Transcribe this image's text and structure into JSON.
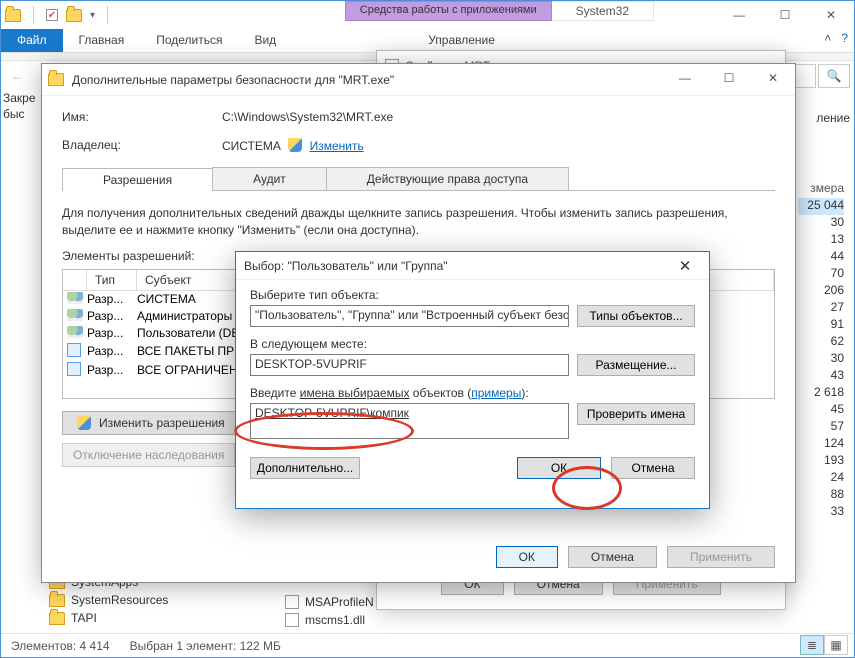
{
  "explorer": {
    "context_tab": "Средства работы с приложениями",
    "path_label": "System32",
    "ribbon": {
      "file": "Файл",
      "home": "Главная",
      "share": "Поделиться",
      "view": "Вид",
      "manage": "Управление"
    },
    "left_clip": "Закре\nбыс",
    "right_clip": "ление",
    "size_header": "змера",
    "sizes": [
      "25 044",
      "30",
      "13",
      "44",
      "70",
      "206",
      "27",
      "91",
      "62",
      "30",
      "43",
      "2 618",
      "45",
      "57",
      "124",
      "193",
      "24",
      "88",
      "33"
    ],
    "folder_items": [
      "SystemResources",
      "TAPI"
    ],
    "folder_item_top": "SystemApps",
    "file_items": [
      "MSAProfileN",
      "mscms1.dll"
    ],
    "status": {
      "count_label": "Элементов: 4 414",
      "selected_label": "Выбран 1 элемент: 122 МБ"
    }
  },
  "props": {
    "title": "Свойства: MRT.exe",
    "ok": "ОК",
    "cancel": "Отмена",
    "apply": "Применить"
  },
  "advsec": {
    "title": "Дополнительные параметры безопасности для \"MRT.exe\"",
    "name_label": "Имя:",
    "name_value": "C:\\Windows\\System32\\MRT.exe",
    "owner_label": "Владелец:",
    "owner_value": "СИСТЕМА",
    "change_link": "Изменить",
    "tabs": {
      "perm": "Разрешения",
      "audit": "Аудит",
      "effective": "Действующие права доступа"
    },
    "hint": "Для получения дополнительных сведений дважды щелкните запись разрешения. Чтобы изменить запись разрешения, выделите ее и нажмите кнопку \"Изменить\" (если она доступна).",
    "perm_label": "Элементы разрешений:",
    "cols": {
      "type": "Тип",
      "subject": "Субъект"
    },
    "rows": [
      {
        "icon": "users",
        "type": "Разр...",
        "subject": "СИСТЕМА"
      },
      {
        "icon": "users",
        "type": "Разр...",
        "subject": "Администраторы"
      },
      {
        "icon": "users",
        "type": "Разр...",
        "subject": "Пользователи (DE..."
      },
      {
        "icon": "pkg",
        "type": "Разр...",
        "subject": "ВСЕ ПАКЕТЫ ПРИЛ..."
      },
      {
        "icon": "pkg",
        "type": "Разр...",
        "subject": "ВСЕ ОГРАНИЧЕНН..."
      }
    ],
    "change_perms": "Изменить разрешения",
    "disable_inherit": "Отключение наследования",
    "ok": "ОК",
    "cancel": "Отмена",
    "apply": "Применить"
  },
  "select": {
    "title": "Выбор: \"Пользователь\" или \"Группа\"",
    "obj_type_label": "Выберите тип объекта:",
    "obj_type_value": "\"Пользователь\", \"Группа\" или \"Встроенный субъект безопасност",
    "obj_type_btn": "Типы объектов...",
    "location_label": "В следующем месте:",
    "location_value": "DESKTOP-5VUPRIF",
    "location_btn": "Размещение...",
    "names_label_a": "Введите ",
    "names_label_b": "имена выбираемых",
    "names_label_c": " объектов (",
    "names_link": "примеры",
    "names_label_d": "):",
    "names_value": "DESKTOP-5VUPRIF\\компик",
    "check_names_btn": "Проверить имена",
    "advanced_btn": "Дополнительно...",
    "ok": "ОК",
    "cancel": "Отмена"
  }
}
